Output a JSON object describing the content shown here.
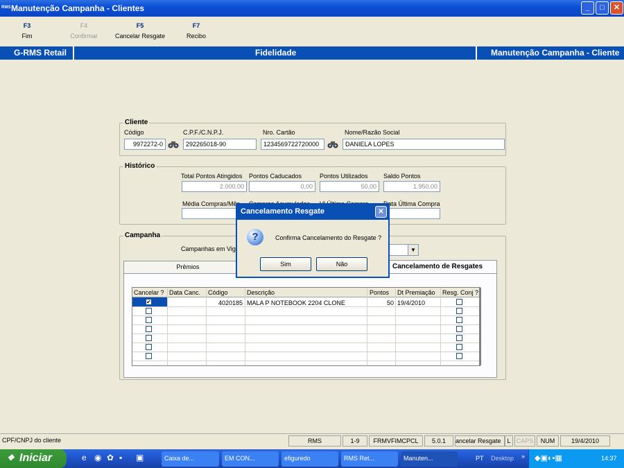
{
  "window": {
    "title": "Manutenção Campanha - Clientes",
    "logo": "RMS",
    "min": "_",
    "max": "□",
    "close": "✕"
  },
  "fkeys": [
    {
      "key": "F3",
      "label": "Fim",
      "enabled": true
    },
    {
      "key": "F4",
      "label": "Confirmar",
      "enabled": false
    },
    {
      "key": "F5",
      "label": "Cancelar Resgate",
      "enabled": true
    },
    {
      "key": "F7",
      "label": "Recibo",
      "enabled": true
    }
  ],
  "header": {
    "left": "G-RMS Retail",
    "center": "Fidelidade",
    "right": "Manutenção Campanha - Cliente"
  },
  "cliente": {
    "title": "Cliente",
    "codigo_label": "Código",
    "codigo": "9972272-0",
    "cpf_label": "C.P.F./C.N.P.J.",
    "cpf": "292265018-90",
    "cartao_label": "Nro. Cartão",
    "cartao": "1234569722720000",
    "nome_label": "Nome/Razão Social",
    "nome": "DANIELA LOPES"
  },
  "historico": {
    "title": "Histórico",
    "total_label": "Total Pontos Atingidos",
    "total": "2.000,00",
    "caducados_label": "Pontos Caducados",
    "caducados": "0,00",
    "utilizados_label": "Pontos Utilizados",
    "utilizados": "50,00",
    "saldo_label": "Saldo Pontos",
    "saldo": "1.950,00",
    "media_label": "Média Compras/Mês",
    "compras_label": "Compras Acumuladas",
    "vlultima_label": "Vl Última Compra",
    "dtultima_label": "Data Última Compra"
  },
  "campanha": {
    "title": "Campanha",
    "vigencia_label": "Campanhas em Vigência",
    "tab_premios": "Prêmios",
    "tab_cancel": "Cancelamento de Resgates"
  },
  "grid": {
    "headers": [
      "Cancelar ?",
      "Data Canc.",
      "Código",
      "Descrição",
      "Pontos",
      "Dt Premiação",
      "Resg. Conj ?"
    ],
    "row": {
      "checked": "✔",
      "codigo": "4020185",
      "descricao": "MALA P NOTEBOOK 2204 CLONE",
      "pontos": "50",
      "dt": "19/4/2010"
    }
  },
  "dialog": {
    "title": "Cancelamento Resgate",
    "message": "Confirma Cancelamento do Resgate ?",
    "yes": "Sim",
    "no": "Não",
    "icon": "?"
  },
  "status": {
    "hint": "CPF/CNPJ do cliente",
    "app": "RMS",
    "range": "1-9",
    "form": "FRMVFIMCPCL",
    "version": "5.0.1",
    "action": "ancelar Resgate",
    "l": "L",
    "caps": "CAPS",
    "num": "NUM",
    "date": "19/4/2010"
  },
  "taskbar": {
    "start": "Iniciar",
    "tasks": [
      "Caixa de...",
      "EM CON...",
      "efiguredo",
      "RMS Ret...",
      "Manuten..."
    ],
    "lang": "PT",
    "desktop": "Desktop",
    "chev": "»",
    "time": "14:37"
  },
  "colors": {
    "titlebar": "#0a4fd6",
    "bluebar": "#0a4fb4",
    "face": "#ece9d8"
  }
}
